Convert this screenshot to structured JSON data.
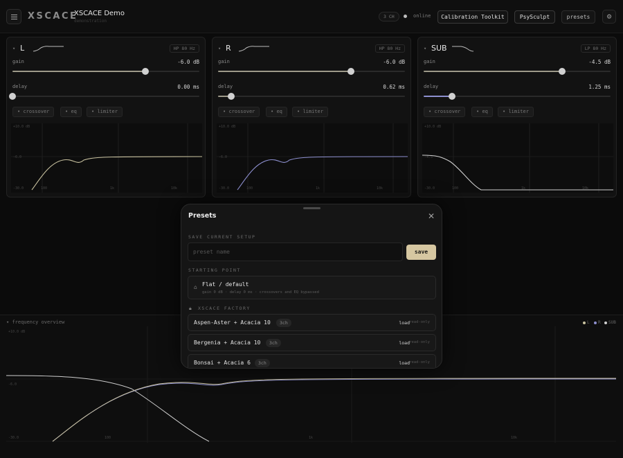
{
  "app": {
    "logo": "XSCACE",
    "title": "XSCACE Demo",
    "subtitle": "demonstration",
    "channel_count": "3 CH",
    "status": "online",
    "buttons": {
      "calibration": "Calibration Toolkit",
      "psysculpt": "PsySculpt",
      "presets": "presets"
    }
  },
  "channels": [
    {
      "name": "L",
      "filter": "HP 80 Hz",
      "gain_label": "gain",
      "gain": "-6.0 dB",
      "gain_pos": 0.71,
      "delay_label": "delay",
      "delay": "0.00 ms",
      "delay_pos": 0.0,
      "tools": [
        "crossover",
        "eq",
        "limiter"
      ],
      "graph_labels": {
        "top": "+10.0 dB",
        "mid": "-6.0",
        "bottom": "-30.0",
        "f1": "100",
        "f2": "1k",
        "f3": "10k"
      }
    },
    {
      "name": "R",
      "filter": "HP 80 Hz",
      "gain_label": "gain",
      "gain": "-6.0 dB",
      "gain_pos": 0.71,
      "delay_label": "delay",
      "delay": "0.62 ms",
      "delay_pos": 0.07,
      "tools": [
        "crossover",
        "eq",
        "limiter"
      ],
      "graph_labels": {
        "top": "+10.0 dB",
        "mid": "-6.0",
        "bottom": "-30.0",
        "f1": "100",
        "f2": "1k",
        "f3": "10k"
      }
    },
    {
      "name": "SUB",
      "filter": "LP 80 Hz",
      "gain_label": "gain",
      "gain": "-4.5 dB",
      "gain_pos": 0.74,
      "delay_label": "delay",
      "delay": "1.25 ms",
      "delay_pos": 0.15,
      "tools": [
        "crossover",
        "eq",
        "limiter"
      ],
      "graph_labels": {
        "top": "+10.0 dB",
        "mid": "-4.5",
        "bottom": "-30.0",
        "f1": "100",
        "f2": "1k",
        "f3": "10k"
      }
    }
  ],
  "overview": {
    "title": "frequency overview",
    "legend": [
      "L",
      "R",
      "SUB"
    ],
    "labels": {
      "top": "+10.0 dB",
      "mid": "-6.0",
      "bottom": "-30.0",
      "f1": "100",
      "f2": "1k",
      "f3": "10k"
    }
  },
  "presets_modal": {
    "title": "Presets",
    "save_section": "SAVE CURRENT SETUP",
    "input_placeholder": "preset name",
    "save_label": "save",
    "starting_section": "STARTING POINT",
    "starting": {
      "title": "Flat / default",
      "desc": "gain 0 dB · delay 0 ms · crossovers and EQ bypassed"
    },
    "factory_section": "XSCACE FACTORY",
    "load_label": "load",
    "readonly_label": "read-only",
    "factory": [
      {
        "name": "Aspen-Aster + Acacia 10",
        "ch": "3ch"
      },
      {
        "name": "Bergenia + Acacia 10",
        "ch": "3ch"
      },
      {
        "name": "Bonsai + Acacia 6",
        "ch": "3ch"
      }
    ]
  },
  "colors": {
    "accent": "#d6c7a1",
    "L": "#c9c2a0",
    "R": "#8e90d0",
    "SUB": "#cfcfcf"
  }
}
